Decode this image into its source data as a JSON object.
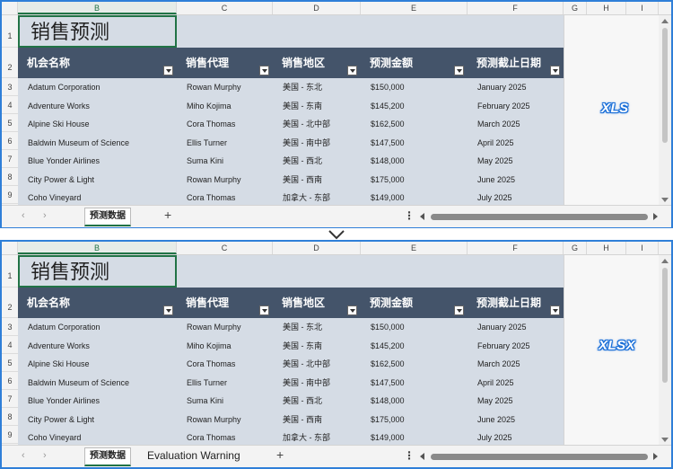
{
  "columns": [
    "B",
    "C",
    "D",
    "E",
    "F",
    "G",
    "H",
    "I"
  ],
  "rows": [
    "1",
    "2",
    "3",
    "4",
    "5",
    "6",
    "7",
    "8",
    "9"
  ],
  "title": "销售预测",
  "headers": [
    "机会名称",
    "销售代理",
    "销售地区",
    "预测金额",
    "预测截止日期"
  ],
  "data_rows": [
    [
      "Adatum Corporation",
      "Rowan Murphy",
      "美国 - 东北",
      "$150,000",
      "January 2025"
    ],
    [
      "Adventure Works",
      "Miho Kojima",
      "美国 - 东南",
      "$145,200",
      "February 2025"
    ],
    [
      "Alpine Ski House",
      "Cora Thomas",
      "美国 - 北中部",
      "$162,500",
      "March 2025"
    ],
    [
      "Baldwin Museum of Science",
      "Ellis Turner",
      "美国 - 南中部",
      "$147,500",
      "April 2025"
    ],
    [
      "Blue Yonder Airlines",
      "Suma Kini",
      "美国 - 西北",
      "$148,000",
      "May 2025"
    ],
    [
      "City Power & Light",
      "Rowan Murphy",
      "美国 - 西南",
      "$175,000",
      "June 2025"
    ],
    [
      "Coho Vineyard",
      "Cora Thomas",
      "加拿大 - 东部",
      "$149,000",
      "July 2025"
    ]
  ],
  "panes": {
    "top": {
      "badge": "XLS",
      "sheet_tab": "预测数据"
    },
    "bottom": {
      "badge": "XLSX",
      "sheet_tab": "预测数据",
      "extra_tab": "Evaluation Warning"
    }
  },
  "colors": {
    "header_bg": "#44546a",
    "table_bg": "#d5dce5",
    "selection": "#217346",
    "pane_border": "#2f7fd8"
  }
}
